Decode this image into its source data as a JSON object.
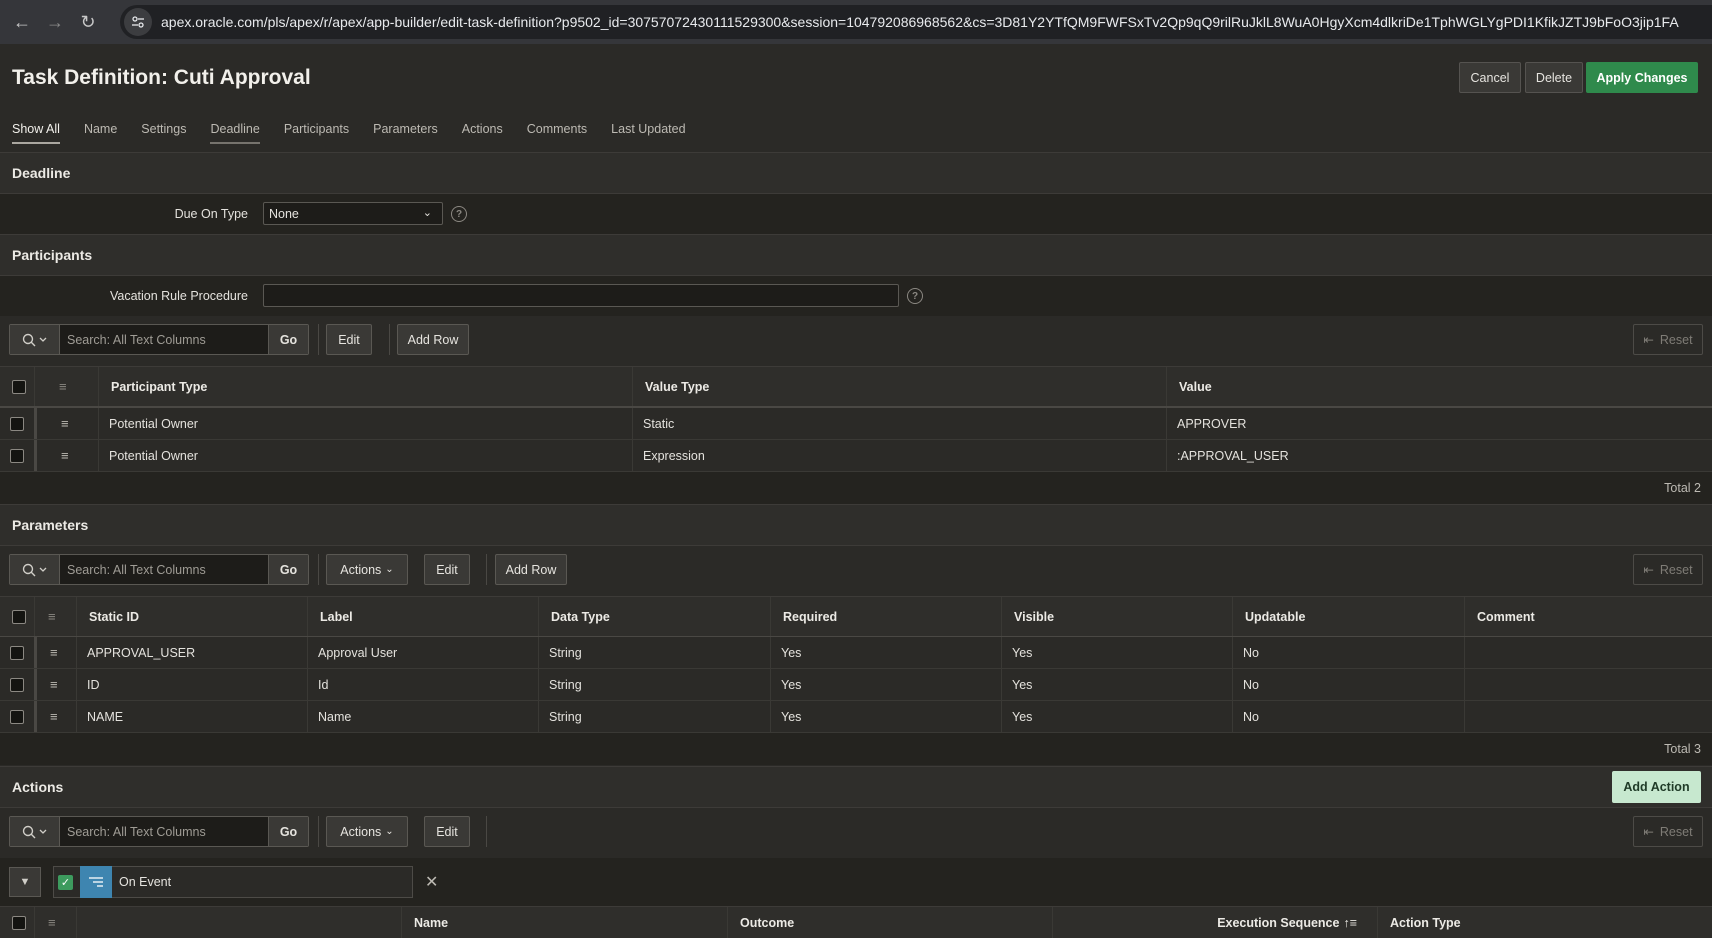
{
  "browser": {
    "url": "apex.oracle.com/pls/apex/r/apex/app-builder/edit-task-definition?p9502_id=30757072430111529300&session=104792086968562&cs=3D81Y2YTfQM9FWFSxTv2Qp9qQ9rilRuJklL8WuA0HgyXcm4dlkriDe1TphWGLYgPDI1KfikJZTJ9bFoO3jip1FA"
  },
  "header": {
    "title": "Task Definition: Cuti Approval",
    "cancel_label": "Cancel",
    "delete_label": "Delete",
    "apply_label": "Apply Changes"
  },
  "tabs": [
    "Show All",
    "Name",
    "Settings",
    "Deadline",
    "Participants",
    "Parameters",
    "Actions",
    "Comments",
    "Last Updated"
  ],
  "deadline": {
    "title": "Deadline",
    "due_on_type_label": "Due On Type",
    "due_on_type_value": "None"
  },
  "participants": {
    "title": "Participants",
    "vacation_label": "Vacation Rule Procedure",
    "vacation_value": "",
    "search_placeholder": "Search: All Text Columns",
    "go_label": "Go",
    "edit_label": "Edit",
    "add_row_label": "Add Row",
    "reset_label": "Reset",
    "columns": [
      "Participant Type",
      "Value Type",
      "Value"
    ],
    "rows": [
      [
        "Potential Owner",
        "Static",
        "APPROVER"
      ],
      [
        "Potential Owner",
        "Expression",
        ":APPROVAL_USER"
      ]
    ],
    "total": "Total 2"
  },
  "parameters": {
    "title": "Parameters",
    "search_placeholder": "Search: All Text Columns",
    "go_label": "Go",
    "actions_label": "Actions",
    "edit_label": "Edit",
    "add_row_label": "Add Row",
    "reset_label": "Reset",
    "columns": [
      "Static ID",
      "Label",
      "Data Type",
      "Required",
      "Visible",
      "Updatable",
      "Comment"
    ],
    "rows": [
      [
        "APPROVAL_USER",
        "Approval User",
        "String",
        "Yes",
        "Yes",
        "No",
        ""
      ],
      [
        "ID",
        "Id",
        "String",
        "Yes",
        "Yes",
        "No",
        ""
      ],
      [
        "NAME",
        "Name",
        "String",
        "Yes",
        "Yes",
        "No",
        ""
      ]
    ],
    "total": "Total 3"
  },
  "actions": {
    "title": "Actions",
    "add_action_label": "Add Action",
    "search_placeholder": "Search: All Text Columns",
    "go_label": "Go",
    "actions_label": "Actions",
    "edit_label": "Edit",
    "reset_label": "Reset",
    "filter_label": "On Event",
    "columns": [
      "Name",
      "Outcome",
      "Execution Sequence",
      "Action Type"
    ]
  },
  "colors": {
    "accent_green": "#2f8a4c",
    "add_action_bg": "#c7e8cf",
    "filter_blue": "#3e85b0"
  }
}
